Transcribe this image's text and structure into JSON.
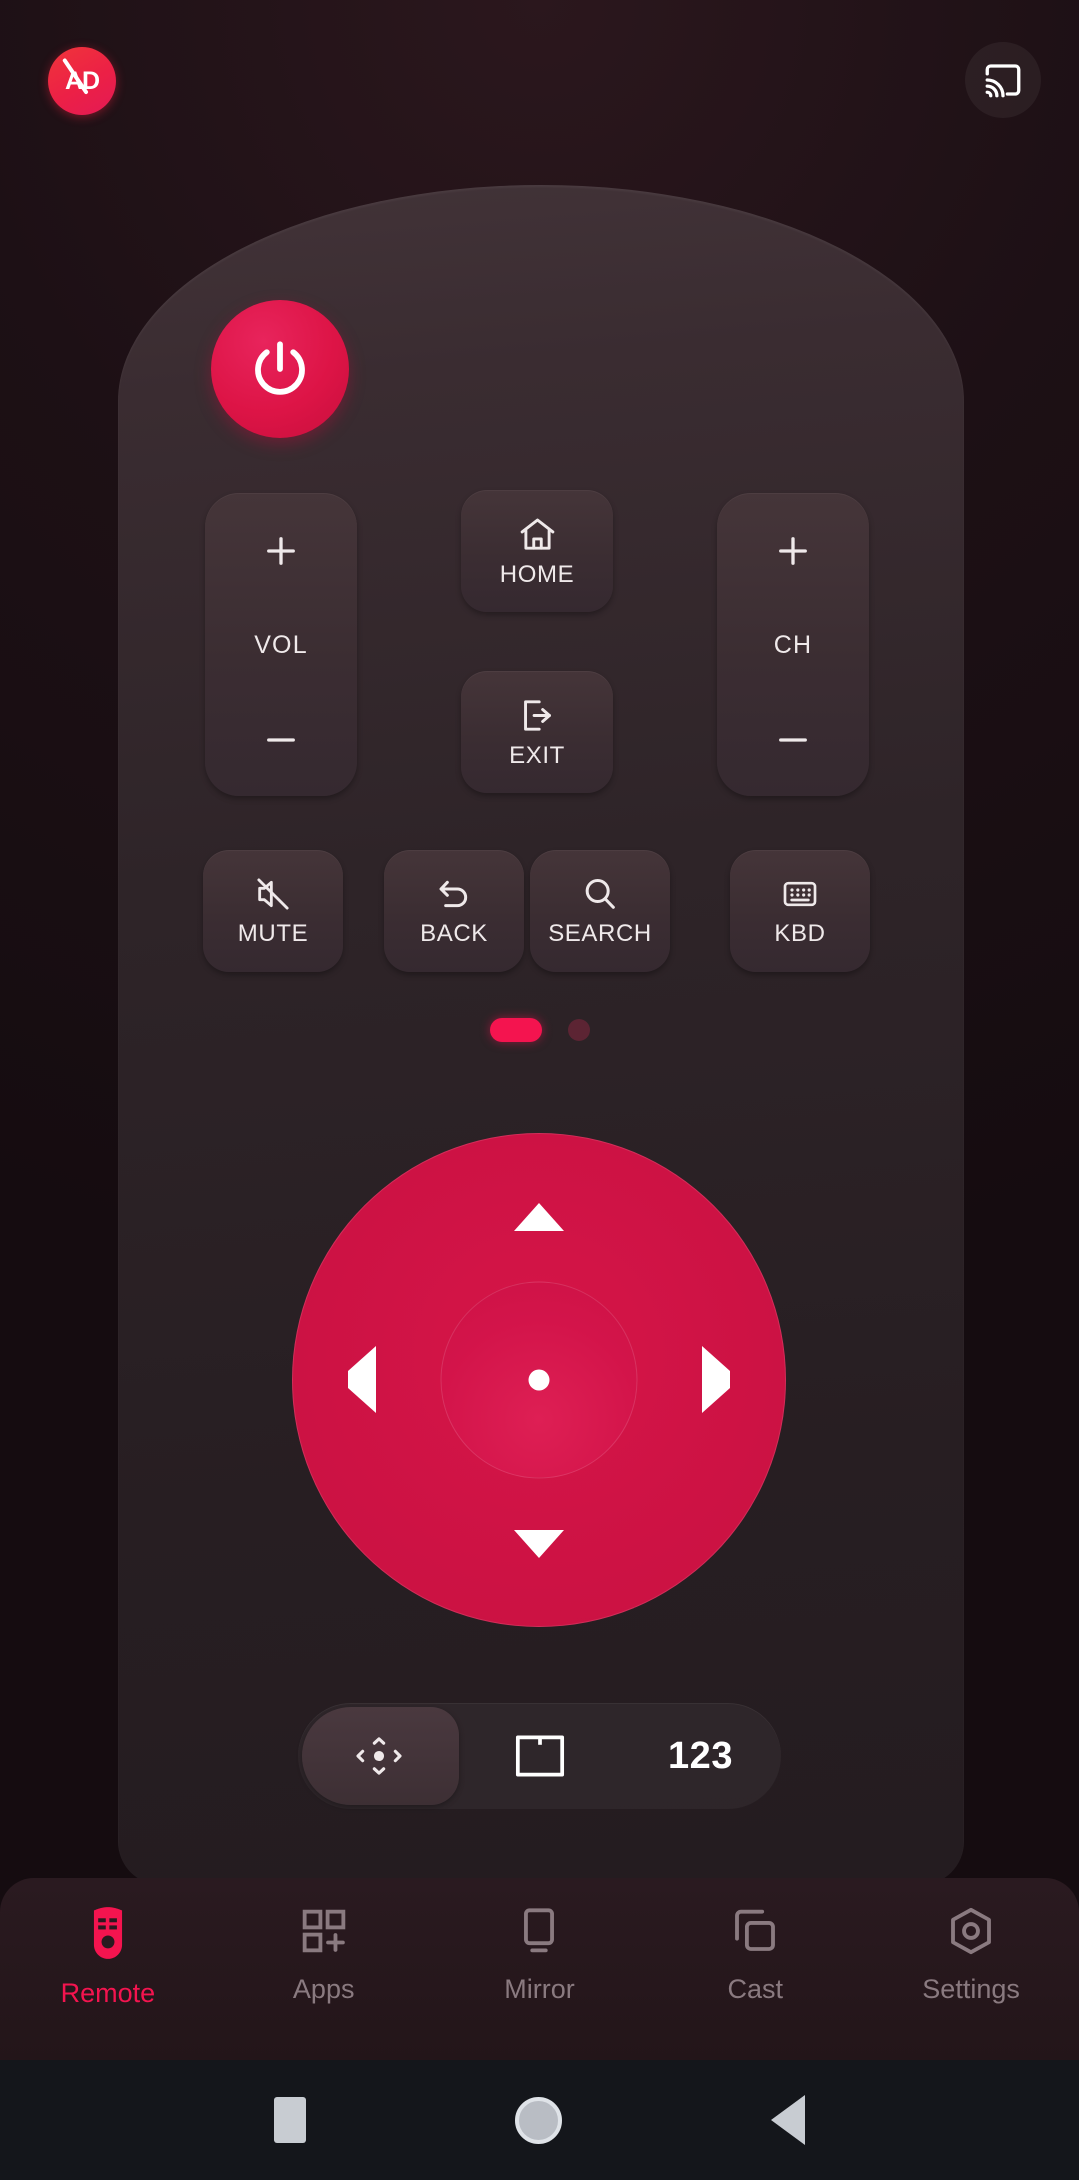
{
  "topbar": {
    "ad_button": {
      "label": "AD",
      "name": "remove-ads-button"
    },
    "cast_button": {
      "label": "Cast",
      "name": "cast-button"
    }
  },
  "remote": {
    "power": {
      "label": "Power"
    },
    "volume": {
      "plus": "+",
      "label": "VOL",
      "minus": "−"
    },
    "channel": {
      "plus": "+",
      "label": "CH",
      "minus": "−"
    },
    "home": {
      "label": "HOME"
    },
    "exit": {
      "label": "EXIT"
    },
    "function_row": [
      {
        "label": "MUTE",
        "icon": "mute-icon"
      },
      {
        "label": "BACK",
        "icon": "back-icon"
      },
      {
        "label": "SEARCH",
        "icon": "search-icon"
      },
      {
        "label": "KBD",
        "icon": "keyboard-icon"
      }
    ],
    "page_indicator": {
      "total": 2,
      "current": 1
    },
    "dpad": {
      "up": "Up",
      "down": "Down",
      "left": "Left",
      "right": "Right",
      "ok": "OK"
    },
    "mode_pill": {
      "dpad_mode": "D-Pad",
      "touchpad_mode": "Touchpad",
      "numeric_mode": "123"
    }
  },
  "bottom_nav": {
    "items": [
      {
        "label": "Remote",
        "icon": "remote-icon",
        "active": true
      },
      {
        "label": "Apps",
        "icon": "apps-icon",
        "active": false
      },
      {
        "label": "Mirror",
        "icon": "mirror-icon",
        "active": false
      },
      {
        "label": "Cast",
        "icon": "cast-screens-icon",
        "active": false
      },
      {
        "label": "Settings",
        "icon": "settings-icon",
        "active": false
      }
    ]
  },
  "system_nav": {
    "recents": "Recents",
    "home": "Home",
    "back": "Back"
  },
  "colors": {
    "accent": "#f4144f",
    "power": "#dd1446",
    "dpad": "#cf1345",
    "background": "#1d1015",
    "remote_body": "#342830",
    "key": "#3b2d32",
    "text": "#efe9ea",
    "nav_inactive": "#8a7a80"
  }
}
